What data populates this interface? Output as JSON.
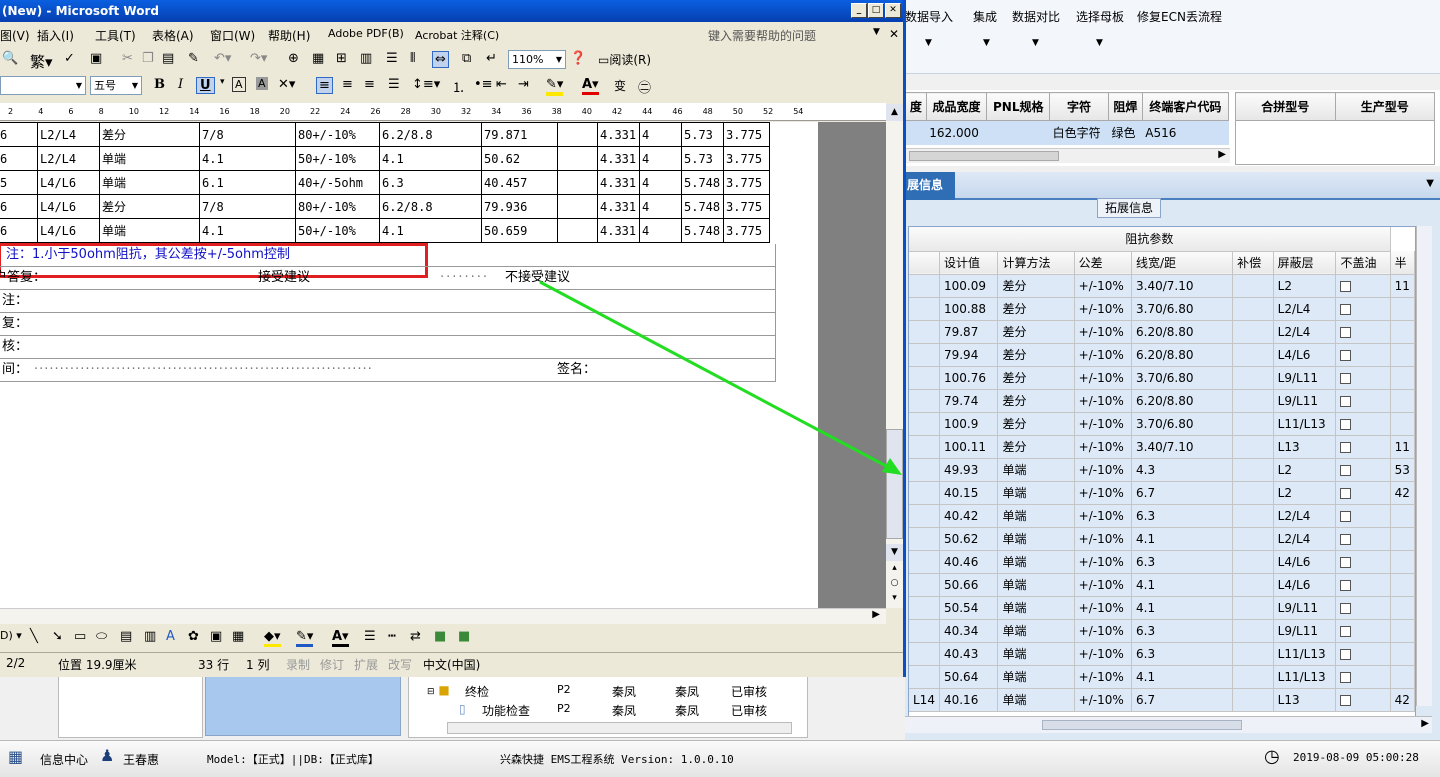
{
  "word": {
    "title": "(New) - Microsoft Word",
    "menu": [
      "图(V)",
      "插入(I)",
      "工具(T)",
      "表格(A)",
      "窗口(W)",
      "帮助(H)",
      "Adobe PDF(B)",
      "Acrobat 注释(C)"
    ],
    "help_placeholder": "键入需要帮助的问题",
    "zoom": "110%",
    "read_label": "阅读(R)",
    "font_size": "五号",
    "ruler_ticks": [
      "2",
      "4",
      "6",
      "8",
      "10",
      "12",
      "14",
      "16",
      "18",
      "20",
      "22",
      "24",
      "26",
      "28",
      "30",
      "32",
      "34",
      "36",
      "38",
      "40",
      "42",
      "44",
      "46",
      "48",
      "50",
      "52",
      "54"
    ],
    "table_rows": [
      [
        "6",
        "L2/L4",
        "差分",
        "7/8",
        "80+/-10%",
        "6.2/8.8",
        "79.871",
        "",
        "4.331",
        "4",
        "5.73",
        "3.775"
      ],
      [
        "6",
        "L2/L4",
        "单端",
        "4.1",
        "50+/-10%",
        "4.1",
        "50.62",
        "",
        "4.331",
        "4",
        "5.73",
        "3.775"
      ],
      [
        "5",
        "L4/L6",
        "单端",
        "6.1",
        "40+/-5ohm",
        "6.3",
        "40.457",
        "",
        "4.331",
        "4",
        "5.748",
        "3.775"
      ],
      [
        "6",
        "L4/L6",
        "差分",
        "7/8",
        "80+/-10%",
        "6.2/8.8",
        "79.936",
        "",
        "4.331",
        "4",
        "5.748",
        "3.775"
      ],
      [
        "6",
        "L4/L6",
        "单端",
        "4.1",
        "50+/-10%",
        "4.1",
        "50.659",
        "",
        "4.331",
        "4",
        "5.748",
        "3.775"
      ]
    ],
    "note": "注：1.小于50ohm阻抗，其公差按+/-5ohm控制",
    "reply_label": "户答复：",
    "accept": "接受建议",
    "reject": "不接受建议",
    "remark_label": "注：",
    "recheck_label": "复：",
    "audit_label": "核：",
    "time_label": "间：",
    "sign_label": "签名：",
    "status": {
      "page": "2/2",
      "position": "位置 19.9厘米",
      "line": "33 行",
      "col": "1 列",
      "rec": "录制",
      "trk": "修订",
      "ext": "扩展",
      "ovr": "改写",
      "lang": "中文(中国)"
    }
  },
  "app": {
    "menu": [
      "数据导入",
      "集成",
      "数据对比",
      "选择母板",
      "修复ECN丢流程"
    ],
    "top_headers": [
      "度",
      "成品宽度",
      "PNL规格",
      "字符",
      "阻焊",
      "终端客户代码"
    ],
    "top_row": [
      "",
      "162.000",
      "",
      "白色字符",
      "绿色",
      "A516"
    ],
    "side_headers": [
      "合拼型号",
      "生产型号"
    ],
    "tab_label": "展信息",
    "subtab_label": "拓展信息",
    "group_header": "阻抗参数",
    "imp_headers": [
      "设计值",
      "计算方法",
      "公差",
      "线宽/距",
      "补偿",
      "屏蔽层",
      "不盖油",
      "半"
    ],
    "imp_rows": [
      [
        "100.09",
        "差分",
        "+/-10%",
        "3.40/7.10",
        "",
        "L2",
        "",
        "11"
      ],
      [
        "100.88",
        "差分",
        "+/-10%",
        "3.70/6.80",
        "",
        "L2/L4",
        "",
        ""
      ],
      [
        "79.87",
        "差分",
        "+/-10%",
        "6.20/8.80",
        "",
        "L2/L4",
        "",
        ""
      ],
      [
        "79.94",
        "差分",
        "+/-10%",
        "6.20/8.80",
        "",
        "L4/L6",
        "",
        ""
      ],
      [
        "100.76",
        "差分",
        "+/-10%",
        "3.70/6.80",
        "",
        "L9/L11",
        "",
        ""
      ],
      [
        "79.74",
        "差分",
        "+/-10%",
        "6.20/8.80",
        "",
        "L9/L11",
        "",
        ""
      ],
      [
        "100.9",
        "差分",
        "+/-10%",
        "3.70/6.80",
        "",
        "L11/L13",
        "",
        ""
      ],
      [
        "100.11",
        "差分",
        "+/-10%",
        "3.40/7.10",
        "",
        "L13",
        "",
        "11"
      ],
      [
        "49.93",
        "单端",
        "+/-10%",
        "4.3",
        "",
        "L2",
        "",
        "53"
      ],
      [
        "40.15",
        "单端",
        "+/-10%",
        "6.7",
        "",
        "L2",
        "",
        "42"
      ],
      [
        "40.42",
        "单端",
        "+/-10%",
        "6.3",
        "",
        "L2/L4",
        "",
        ""
      ],
      [
        "50.62",
        "单端",
        "+/-10%",
        "4.1",
        "",
        "L2/L4",
        "",
        ""
      ],
      [
        "40.46",
        "单端",
        "+/-10%",
        "6.3",
        "",
        "L4/L6",
        "",
        ""
      ],
      [
        "50.66",
        "单端",
        "+/-10%",
        "4.1",
        "",
        "L4/L6",
        "",
        ""
      ],
      [
        "50.54",
        "单端",
        "+/-10%",
        "4.1",
        "",
        "L9/L11",
        "",
        ""
      ],
      [
        "40.34",
        "单端",
        "+/-10%",
        "6.3",
        "",
        "L9/L11",
        "",
        ""
      ],
      [
        "40.43",
        "单端",
        "+/-10%",
        "6.3",
        "",
        "L11/L13",
        "",
        ""
      ],
      [
        "50.64",
        "单端",
        "+/-10%",
        "4.1",
        "",
        "L11/L13",
        "",
        ""
      ]
    ],
    "imp_last": {
      "layer": "L14",
      "n": "40",
      "val": "40.16",
      "method": "单端",
      "tol": "+/-10%",
      "lw": "6.7",
      "shield": "L13",
      "half": "42"
    },
    "tree": [
      {
        "name": "终检",
        "code": "P2",
        "a": "秦凤",
        "b": "秦凤",
        "state": "已审核"
      },
      {
        "name": "功能检查",
        "code": "P2",
        "a": "秦凤",
        "b": "秦凤",
        "state": "已审核"
      }
    ],
    "status": {
      "info": "信息中心",
      "user": "王春惠",
      "model": "Model:【正式】||DB:【正式库】",
      "system": "兴森快捷 EMS工程系统 Version: 1.0.0.10",
      "datetime": "2019-08-09 05:00:28"
    }
  },
  "colors": {
    "annotation_red": "#e02020",
    "arrow_green": "#22dd22",
    "title_blue": "#0a4fc4",
    "note_blue": "#1010c8"
  }
}
